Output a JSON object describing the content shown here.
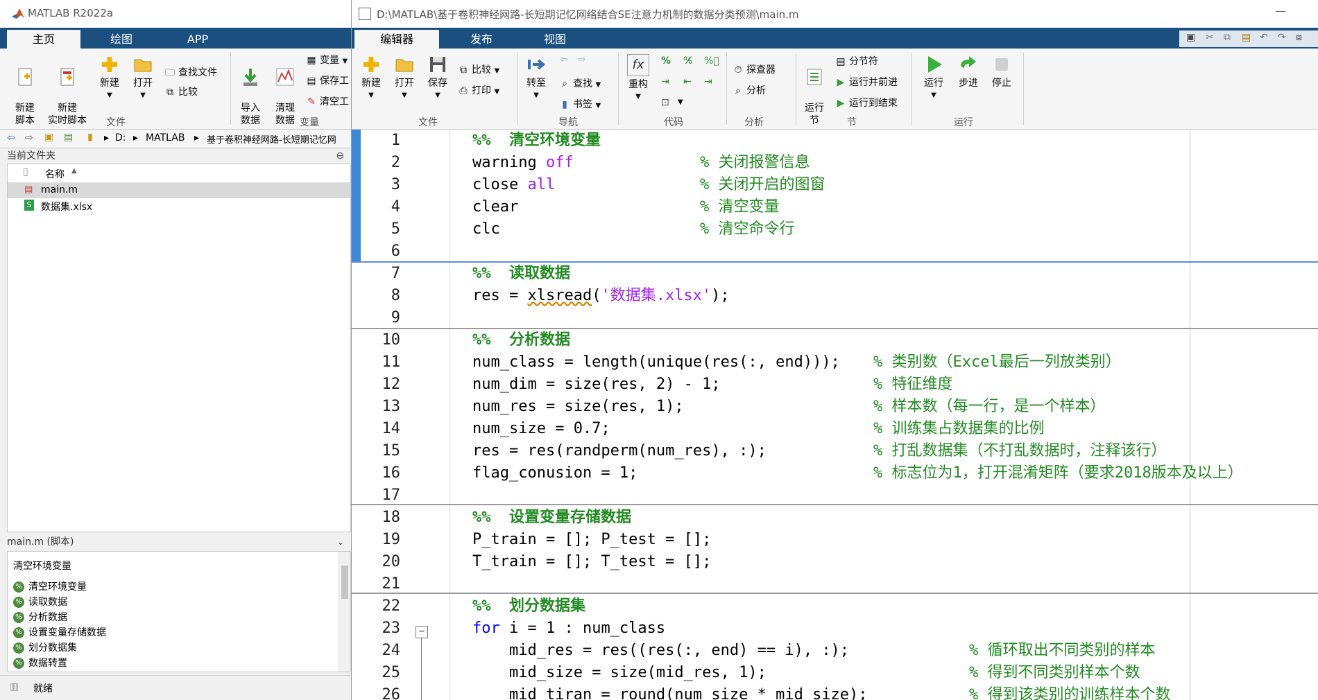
{
  "main_window": {
    "title": "MATLAB R2022a",
    "tabs": [
      "主页",
      "绘图",
      "APP"
    ],
    "ribbon": {
      "new_script": "新建\n脚本",
      "new_live_script": "新建\n实时脚本",
      "new": "新建",
      "open": "打开",
      "find_files": "查找文件",
      "compare": "比较",
      "import_data": "导入\n数据",
      "clean_data": "清理\n数据",
      "variable": "变量",
      "save_workspace": "保存工",
      "clear_workspace": "清空工",
      "group_file": "文件",
      "group_variable": "变量"
    },
    "path": {
      "drive": "D:",
      "seg1": "MATLAB",
      "seg2": "基于卷积神经网路-长短期记忆网"
    },
    "current_folder_label": "当前文件夹",
    "file_list_header": "名称",
    "files": [
      {
        "name": "main.m",
        "type": "m"
      },
      {
        "name": "数据集.xlsx",
        "type": "xlsx"
      }
    ],
    "details_title": "main.m  (脚本)",
    "details_heading": "清空环境变量",
    "outline": [
      "清空环境变量",
      "读取数据",
      "分析数据",
      "设置变量存储数据",
      "划分数据集",
      "数据转置"
    ],
    "status": "就绪"
  },
  "editor_window": {
    "title": "D:\\MATLAB\\基于卷积神经网路-长短期记忆网络结合SE注意力机制的数据分类预测\\main.m",
    "tabs": [
      "编辑器",
      "发布",
      "视图"
    ],
    "ribbon": {
      "new": "新建",
      "open": "打开",
      "save": "保存",
      "compare": "比较",
      "print": "打印",
      "goto": "转至",
      "find": "查找",
      "bookmark": "书签",
      "refactor": "重构",
      "profiler": "探查器",
      "analyze": "分析",
      "run_section": "运行\n节",
      "section_break": "分节符",
      "run_and_advance": "运行并前进",
      "run_to_end": "运行到结束",
      "run": "运行",
      "step": "步进",
      "stop": "停止",
      "group_file": "文件",
      "group_nav": "导航",
      "group_code": "代码",
      "group_analyze": "分析",
      "group_section": "节",
      "group_run": "运行"
    },
    "code_lines": [
      {
        "n": "1",
        "code": "%%  清空环境变量",
        "comment": ""
      },
      {
        "n": "2",
        "code": "warning off",
        "comment": "% 关闭报警信息"
      },
      {
        "n": "3",
        "code": "close all",
        "comment": "% 关闭开启的图窗"
      },
      {
        "n": "4",
        "code": "clear",
        "comment": "% 清空变量"
      },
      {
        "n": "5",
        "code": "clc",
        "comment": "% 清空命令行"
      },
      {
        "n": "6",
        "code": "",
        "comment": ""
      },
      {
        "n": "7",
        "code": "%%  读取数据",
        "comment": ""
      },
      {
        "n": "8",
        "code": "res = xlsread('数据集.xlsx');",
        "comment": ""
      },
      {
        "n": "9",
        "code": "",
        "comment": ""
      },
      {
        "n": "10",
        "code": "%%  分析数据",
        "comment": ""
      },
      {
        "n": "11",
        "code": "num_class = length(unique(res(:, end)));",
        "comment": "% 类别数（Excel最后一列放类别）"
      },
      {
        "n": "12",
        "code": "num_dim = size(res, 2) - 1;",
        "comment": "% 特征维度"
      },
      {
        "n": "13",
        "code": "num_res = size(res, 1);",
        "comment": "% 样本数（每一行，是一个样本）"
      },
      {
        "n": "14",
        "code": "num_size = 0.7;",
        "comment": "% 训练集占数据集的比例"
      },
      {
        "n": "15",
        "code": "res = res(randperm(num_res), :);",
        "comment": "% 打乱数据集（不打乱数据时，注释该行）"
      },
      {
        "n": "16",
        "code": "flag_conusion = 1;",
        "comment": "% 标志位为1，打开混淆矩阵（要求2018版本及以上）"
      },
      {
        "n": "17",
        "code": "",
        "comment": ""
      },
      {
        "n": "18",
        "code": "%%  设置变量存储数据",
        "comment": ""
      },
      {
        "n": "19",
        "code": "P_train = []; P_test = [];",
        "comment": ""
      },
      {
        "n": "20",
        "code": "T_train = []; T_test = [];",
        "comment": ""
      },
      {
        "n": "21",
        "code": "",
        "comment": ""
      },
      {
        "n": "22",
        "code": "%%  划分数据集",
        "comment": ""
      },
      {
        "n": "23",
        "code": "for i = 1 : num_class",
        "comment": ""
      },
      {
        "n": "24",
        "code": "    mid_res = res((res(:, end) == i), :);",
        "comment": "% 循环取出不同类别的样本"
      },
      {
        "n": "25",
        "code": "    mid_size = size(mid_res, 1);",
        "comment": "% 得到不同类别样本个数"
      },
      {
        "n": "26",
        "code": "    mid_tiran = round(num_size * mid_size);",
        "comment": "% 得到该类别的训练样本个数"
      }
    ]
  }
}
